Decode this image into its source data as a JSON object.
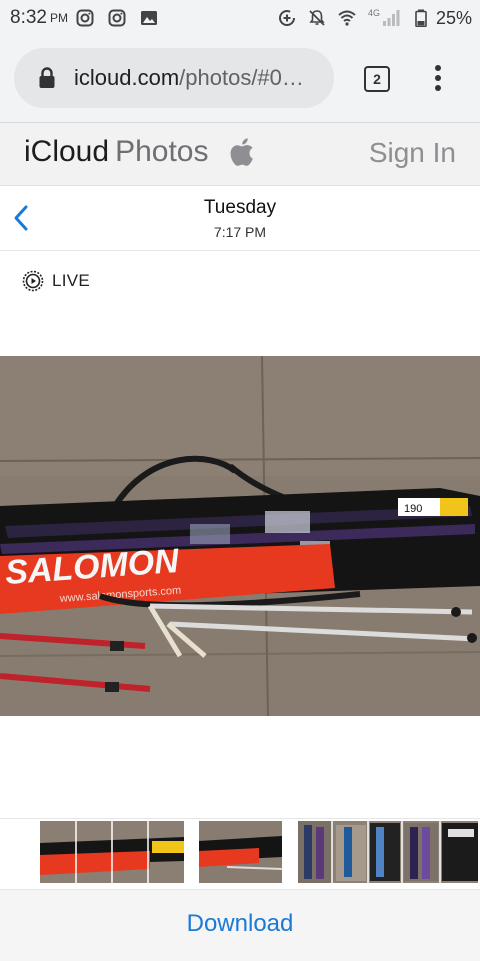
{
  "status_bar": {
    "time": "8:32",
    "ampm": "PM",
    "network_label": "4G",
    "battery": "25%"
  },
  "browser": {
    "url_main": "icloud.com",
    "url_rest": "/photos/#0…",
    "tab_count": "2"
  },
  "header": {
    "brand_icloud": "iCloud",
    "brand_photos": "Photos",
    "sign_in": "Sign In"
  },
  "photo": {
    "date": "Tuesday",
    "time": "7:17 PM",
    "live_label": "LIVE",
    "logo_text": "SALOMON",
    "site_text": "www.salomonsports.com",
    "size_label": "190"
  },
  "footer": {
    "download": "Download"
  },
  "colors": {
    "link_blue": "#1a7ad8",
    "header_bg": "#f2f2f2",
    "browser_bg": "#f1f3f4",
    "concrete": "#8a7f72",
    "bag_red": "#e6391f"
  }
}
